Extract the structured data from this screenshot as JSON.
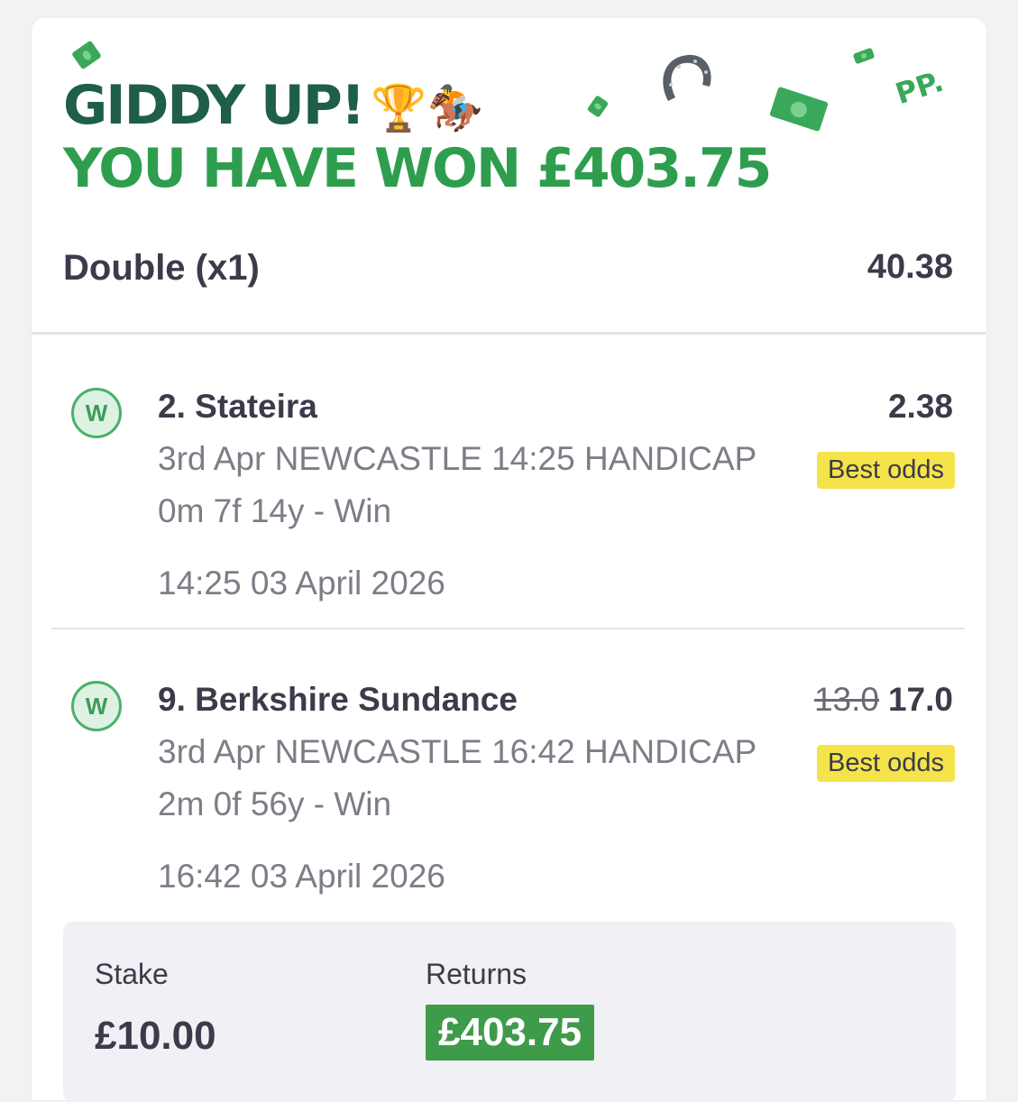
{
  "header": {
    "title": "GIDDY UP!",
    "title_emojis": "🏆🏇",
    "win_message": "YOU HAVE WON £403.75",
    "decoration_icons": [
      "money-bill-icon",
      "horseshoe-icon",
      "money-bill-icon",
      "money-bill-icon",
      "money-bill-icon"
    ],
    "brand_mark": "PP."
  },
  "bet": {
    "type": "Double (x1)",
    "odds": "40.38"
  },
  "selections": [
    {
      "status": "W",
      "name": "2. Stateira",
      "race": "3rd Apr NEWCASTLE 14:25 HANDICAP",
      "distance": "0m 7f 14y - Win",
      "time": "14:25 03 April 2026",
      "old_odds": "",
      "odds": "2.38",
      "badge": "Best odds"
    },
    {
      "status": "W",
      "name": "9. Berkshire Sundance",
      "race": "3rd Apr NEWCASTLE 16:42 HANDICAP",
      "distance": "2m 0f 56y - Win",
      "time": "16:42 03 April 2026",
      "old_odds": "13.0",
      "odds": "17.0",
      "badge": "Best odds"
    }
  ],
  "summary": {
    "stake_label": "Stake",
    "stake_value": "£10.00",
    "returns_label": "Returns",
    "returns_value": "£403.75"
  },
  "colors": {
    "title_dark_green": "#1e5e4a",
    "title_green": "#2e9e4e",
    "badge_yellow": "#f5e34a",
    "returns_green": "#3e9b4a"
  }
}
